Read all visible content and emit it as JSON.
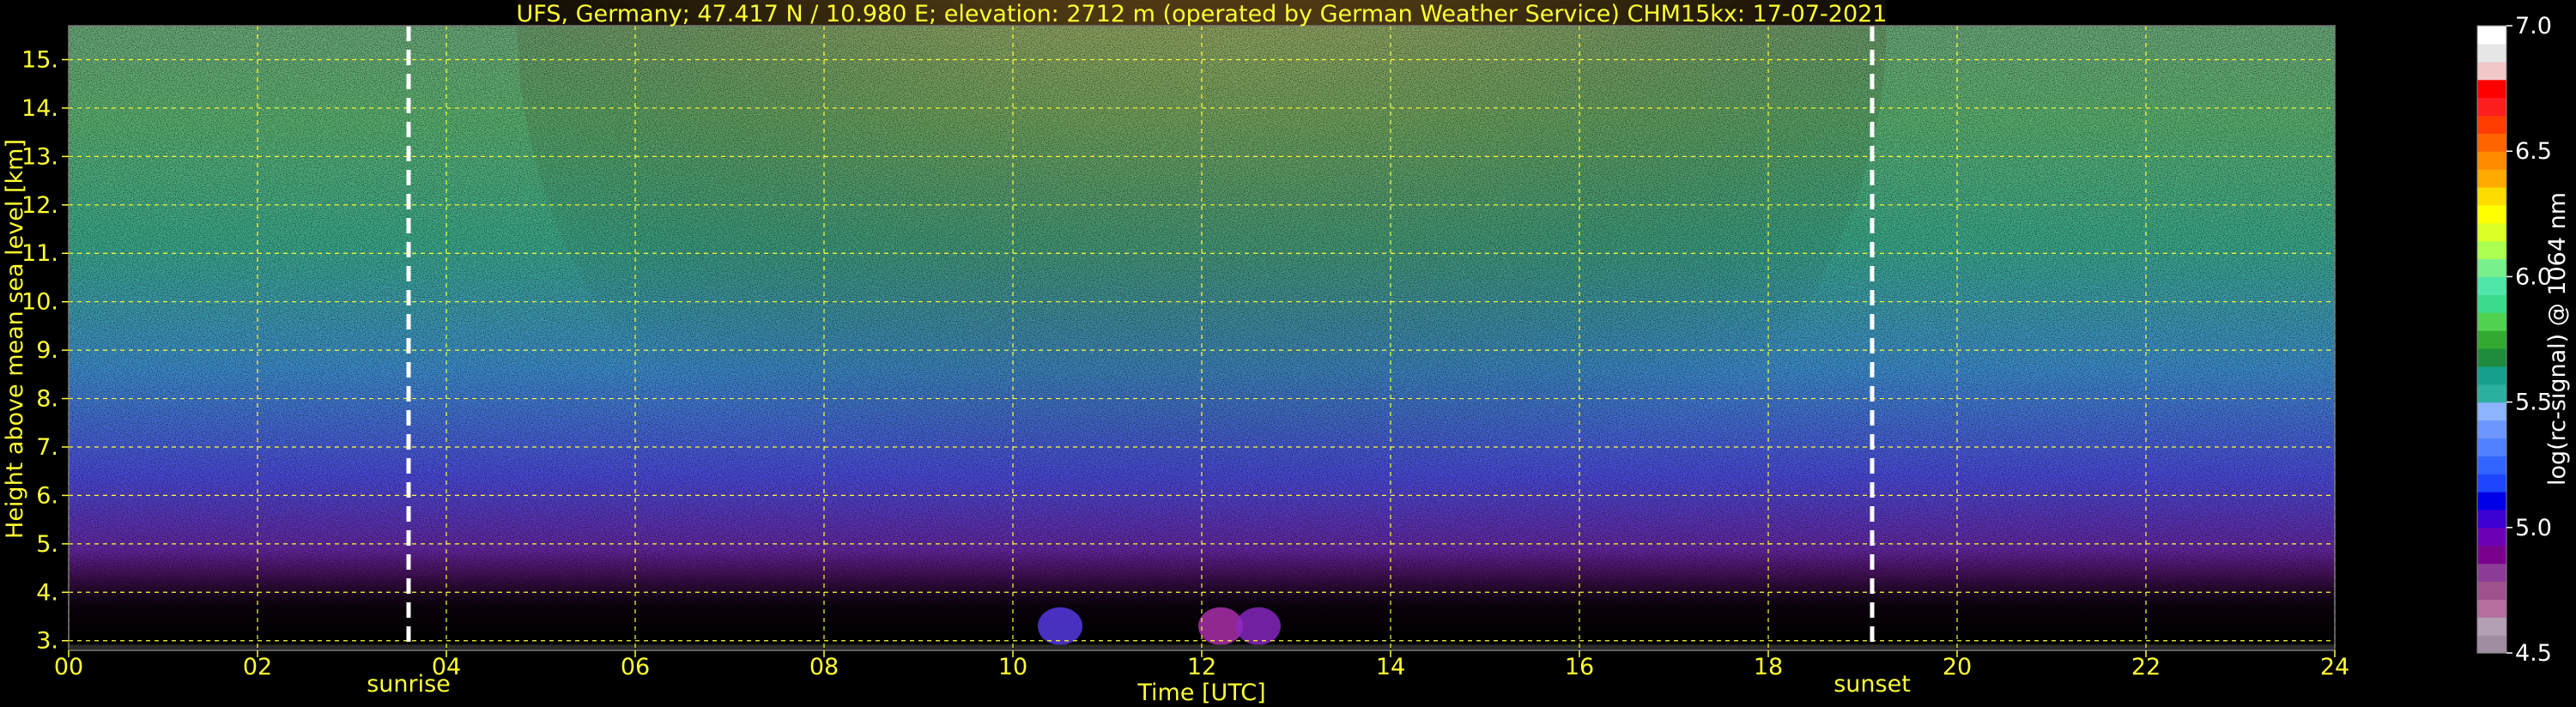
{
  "chart_data": {
    "type": "heatmap",
    "title": "UFS, Germany; 47.417 N / 10.980 E; elevation: 2712 m  (operated by German Weather Service)    CHM15kx: 17-07-2021",
    "xlabel": "Time [UTC]",
    "ylabel": "Height above mean sea level [km]",
    "xlim": [
      0,
      24
    ],
    "ylim": [
      2.8,
      15.7
    ],
    "x_ticks": [
      0,
      2,
      4,
      6,
      8,
      10,
      12,
      14,
      16,
      18,
      20,
      22,
      24
    ],
    "x_tick_labels": [
      "00",
      "02",
      "04",
      "06",
      "08",
      "10",
      "12",
      "14",
      "16",
      "18",
      "20",
      "22",
      "24"
    ],
    "y_ticks": [
      3,
      4,
      5,
      6,
      7,
      8,
      9,
      10,
      11,
      12,
      13,
      14,
      15
    ],
    "y_tick_labels": [
      "3.",
      "4.",
      "5.",
      "6.",
      "7.",
      "8.",
      "9.",
      "10.",
      "11.",
      "12.",
      "13.",
      "14.",
      "15."
    ],
    "grid": true,
    "annotations": [
      {
        "text": "sunrise",
        "x": 3.6
      },
      {
        "text": "sunset",
        "x": 19.1
      }
    ],
    "colorbar": {
      "label": "log(rc-signal) @ 1064 nm",
      "range": [
        4.5,
        7.0
      ],
      "ticks": [
        4.5,
        5.0,
        5.5,
        6.0,
        6.5,
        7.0
      ],
      "tick_labels": [
        "4.5",
        "5.0",
        "5.5",
        "6.0",
        "6.5",
        "7.0"
      ]
    },
    "colors": {
      "background": "#000000",
      "grid": "#ffff33",
      "text": "#ffff33",
      "marker_lines": "#ffffff",
      "colormap": [
        "#a08ca0",
        "#b4a0b4",
        "#b46ea0",
        "#a0508c",
        "#8c3c96",
        "#78008c",
        "#6e00b4",
        "#3c00d2",
        "#0000e6",
        "#1e46ff",
        "#3264ff",
        "#5082ff",
        "#6e96ff",
        "#8cb4ff",
        "#2dafa0",
        "#14a08c",
        "#1e8c3c",
        "#32aa32",
        "#50d250",
        "#3cdc8c",
        "#50e6aa",
        "#78f08c",
        "#aaff50",
        "#dcff28",
        "#ffff00",
        "#ffdc00",
        "#ffaa00",
        "#ff8c00",
        "#ff6400",
        "#ff3c00",
        "#ff1e1e",
        "#ff0000",
        "#f0c8c8",
        "#e6e6e6",
        "#ffffff"
      ]
    }
  }
}
